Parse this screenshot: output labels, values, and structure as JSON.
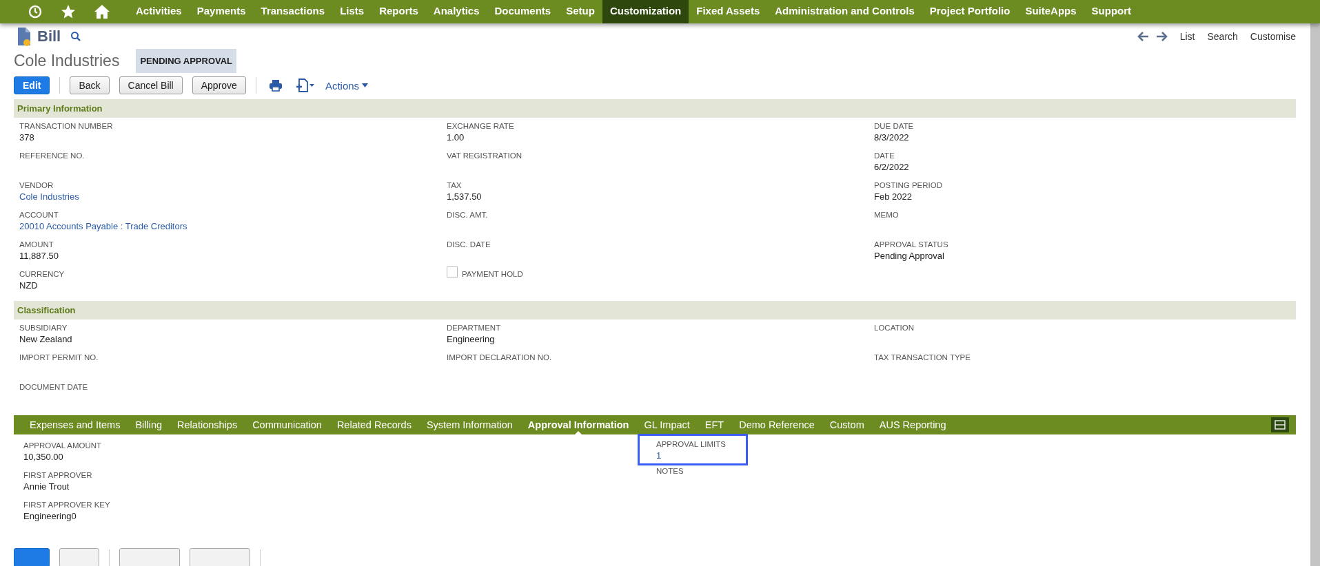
{
  "nav": {
    "items": [
      {
        "label": "Activities",
        "selected": false
      },
      {
        "label": "Payments",
        "selected": false
      },
      {
        "label": "Transactions",
        "selected": false
      },
      {
        "label": "Lists",
        "selected": false
      },
      {
        "label": "Reports",
        "selected": false
      },
      {
        "label": "Analytics",
        "selected": false
      },
      {
        "label": "Documents",
        "selected": false
      },
      {
        "label": "Setup",
        "selected": false
      },
      {
        "label": "Customization",
        "selected": true
      },
      {
        "label": "Fixed Assets",
        "selected": false
      },
      {
        "label": "Administration and Controls",
        "selected": false
      },
      {
        "label": "Project Portfolio",
        "selected": false
      },
      {
        "label": "SuiteApps",
        "selected": false
      },
      {
        "label": "Support",
        "selected": false
      }
    ]
  },
  "header": {
    "record_type": "Bill",
    "links": [
      "List",
      "Search",
      "Customise"
    ],
    "title": "Cole Industries",
    "status": "PENDING APPROVAL"
  },
  "buttons": [
    {
      "label": "Edit",
      "primary": true
    },
    {
      "label": "Back",
      "primary": false
    },
    {
      "label": "Cancel Bill",
      "primary": false
    },
    {
      "label": "Approve",
      "primary": false
    }
  ],
  "actions_label": "Actions",
  "sections": [
    {
      "title": "Primary Information",
      "columns": [
        [
          {
            "label": "TRANSACTION NUMBER",
            "value": "378",
            "kind": "text"
          },
          {
            "label": "REFERENCE NO.",
            "kind": "text"
          },
          {
            "label": "VENDOR",
            "value": "Cole Industries",
            "kind": "link"
          },
          {
            "label": "ACCOUNT",
            "value": "20010 Accounts Payable : Trade Creditors",
            "kind": "link"
          },
          {
            "label": "AMOUNT",
            "value": "11,887.50",
            "kind": "text"
          },
          {
            "label": "CURRENCY",
            "value": "NZD",
            "kind": "text"
          }
        ],
        [
          {
            "label": "EXCHANGE RATE",
            "value": "1.00",
            "kind": "text"
          },
          {
            "label": "VAT REGISTRATION",
            "kind": "text"
          },
          {
            "label": "TAX",
            "value": "1,537.50",
            "kind": "text"
          },
          {
            "label": "DISC. AMT.",
            "kind": "text"
          },
          {
            "label": "DISC. DATE",
            "kind": "text"
          },
          {
            "label": "PAYMENT HOLD",
            "kind": "checkbox",
            "checked": false
          }
        ],
        [
          {
            "label": "DUE DATE",
            "value": "8/3/2022",
            "kind": "text"
          },
          {
            "label": "DATE",
            "value": "6/2/2022",
            "kind": "text"
          },
          {
            "label": "POSTING PERIOD",
            "value": "Feb 2022",
            "kind": "text"
          },
          {
            "label": "MEMO",
            "kind": "text"
          },
          {
            "label": "APPROVAL STATUS",
            "value": "Pending Approval",
            "kind": "text"
          }
        ]
      ]
    },
    {
      "title": "Classification",
      "columns": [
        [
          {
            "label": "SUBSIDIARY",
            "value": "New Zealand",
            "kind": "text"
          },
          {
            "label": "IMPORT PERMIT NO.",
            "kind": "text"
          },
          {
            "label": "DOCUMENT DATE",
            "kind": "text"
          }
        ],
        [
          {
            "label": "DEPARTMENT",
            "value": "Engineering",
            "kind": "text"
          },
          {
            "label": "IMPORT DECLARATION NO.",
            "kind": "text"
          }
        ],
        [
          {
            "label": "LOCATION",
            "kind": "text"
          },
          {
            "label": "TAX TRANSACTION TYPE",
            "kind": "text"
          }
        ]
      ]
    }
  ],
  "subtabs": [
    {
      "label": "Expenses and Items",
      "selected": false
    },
    {
      "label": "Billing",
      "selected": false
    },
    {
      "label": "Relationships",
      "selected": false
    },
    {
      "label": "Communication",
      "selected": false
    },
    {
      "label": "Related Records",
      "selected": false
    },
    {
      "label": "System Information",
      "selected": false
    },
    {
      "label": "Approval Information",
      "selected": true
    },
    {
      "label": "GL Impact",
      "selected": false
    },
    {
      "label": "EFT",
      "selected": false
    },
    {
      "label": "Demo Reference",
      "selected": false
    },
    {
      "label": "Custom",
      "selected": false
    },
    {
      "label": "AUS Reporting",
      "selected": false
    }
  ],
  "approval": {
    "columns": [
      [
        {
          "label": "APPROVAL AMOUNT",
          "value": "10,350.00",
          "kind": "text",
          "highlighted": false
        },
        {
          "label": "FIRST APPROVER",
          "value": "Annie Trout",
          "kind": "text",
          "highlighted": false
        },
        {
          "label": "FIRST APPROVER KEY",
          "value": "Engineering0",
          "kind": "text",
          "highlighted": false
        }
      ],
      [
        {
          "label": "APPROVAL LIMITS",
          "value": "1",
          "kind": "link",
          "highlighted": true
        },
        {
          "label": "NOTES",
          "kind": "text",
          "highlighted": false
        }
      ]
    ]
  }
}
